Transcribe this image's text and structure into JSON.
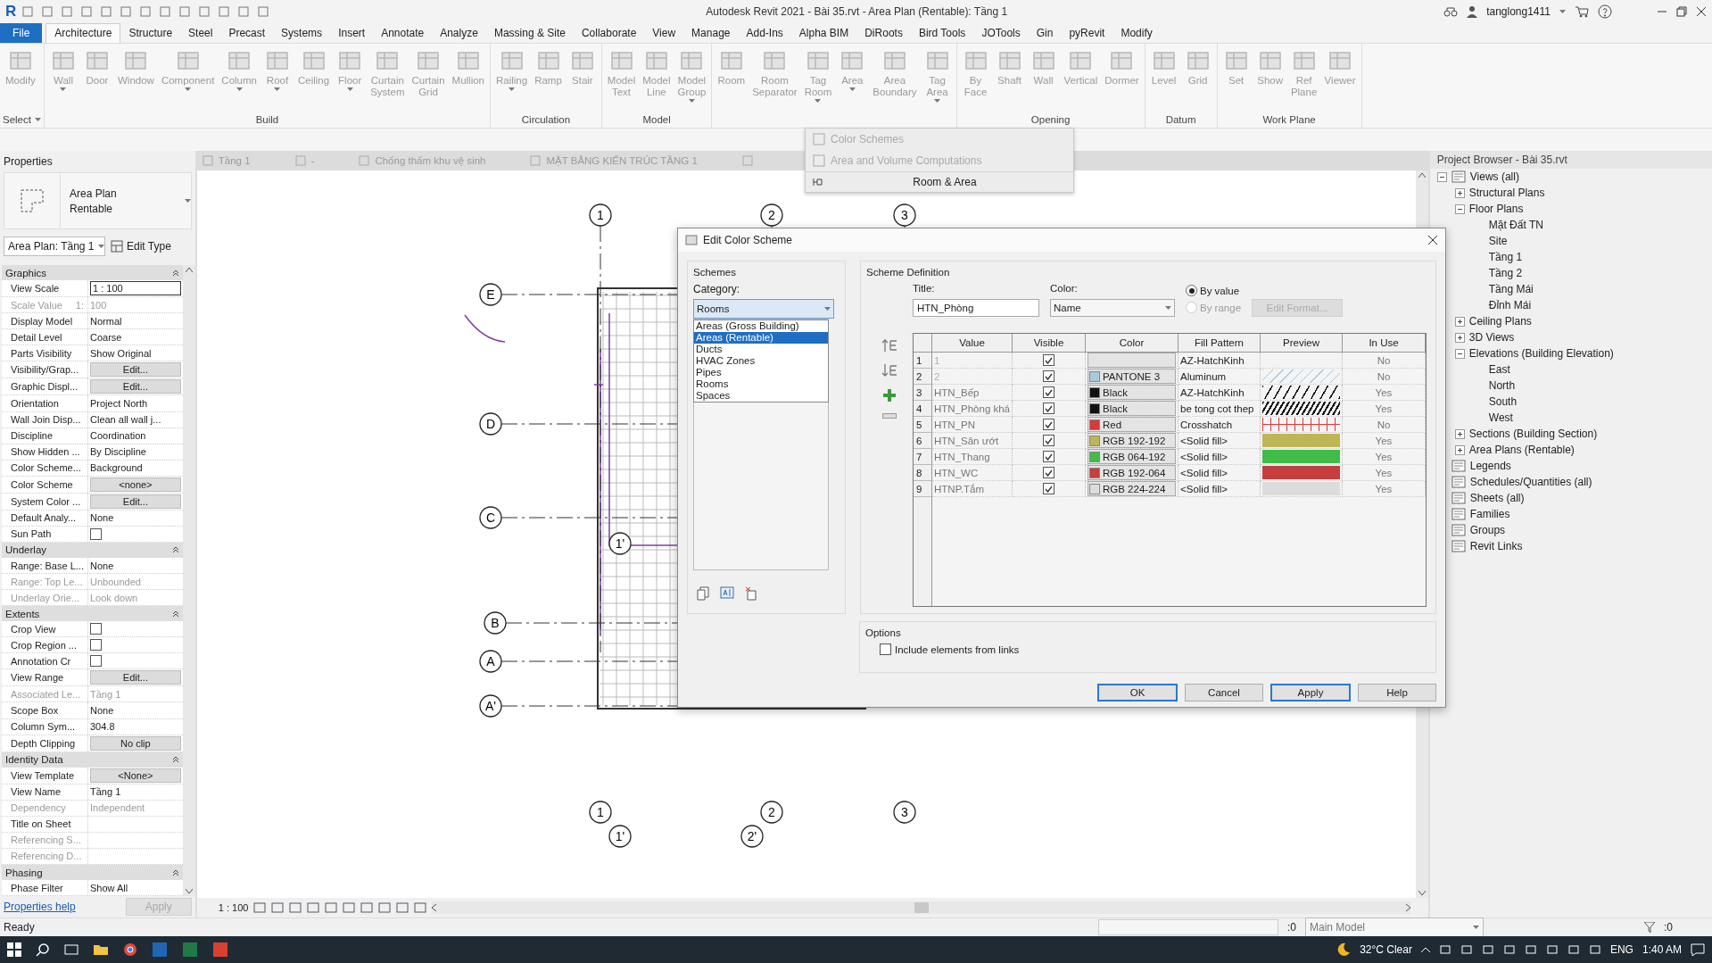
{
  "window": {
    "logo": "R",
    "title": "Autodesk Revit 2021 - Bài 35.rvt - Area Plan (Rentable): Tầng 1",
    "user": "tanglong1411"
  },
  "ribbon_tabs": [
    {
      "label": "File",
      "kind": "file",
      "selected": false
    },
    {
      "label": "Architecture",
      "kind": "tab",
      "selected": true
    },
    {
      "label": "Structure",
      "kind": "tab",
      "selected": false
    },
    {
      "label": "Steel",
      "kind": "tab",
      "selected": false
    },
    {
      "label": "Precast",
      "kind": "tab",
      "selected": false
    },
    {
      "label": "Systems",
      "kind": "tab",
      "selected": false
    },
    {
      "label": "Insert",
      "kind": "tab",
      "selected": false
    },
    {
      "label": "Annotate",
      "kind": "tab",
      "selected": false
    },
    {
      "label": "Analyze",
      "kind": "tab",
      "selected": false
    },
    {
      "label": "Massing & Site",
      "kind": "tab",
      "selected": false
    },
    {
      "label": "Collaborate",
      "kind": "tab",
      "selected": false
    },
    {
      "label": "View",
      "kind": "tab",
      "selected": false
    },
    {
      "label": "Manage",
      "kind": "tab",
      "selected": false
    },
    {
      "label": "Add-Ins",
      "kind": "tab",
      "selected": false
    },
    {
      "label": "Alpha BIM",
      "kind": "tab",
      "selected": false
    },
    {
      "label": "DiRoots",
      "kind": "tab",
      "selected": false
    },
    {
      "label": "Bird Tools",
      "kind": "tab",
      "selected": false
    },
    {
      "label": "JOTools",
      "kind": "tab",
      "selected": false
    },
    {
      "label": "Gin",
      "kind": "tab",
      "selected": false
    },
    {
      "label": "pyRevit",
      "kind": "tab",
      "selected": false
    },
    {
      "label": "Modify",
      "kind": "tab",
      "selected": false
    }
  ],
  "ribbon_panels": [
    {
      "label": "Select",
      "dropdown": true,
      "buttons": [
        {
          "label": "Modify",
          "dropdown": false
        }
      ]
    },
    {
      "label": "Build",
      "dropdown": false,
      "buttons": [
        {
          "label": "Wall",
          "dropdown": true
        },
        {
          "label": "Door",
          "dropdown": false
        },
        {
          "label": "Window",
          "dropdown": false
        },
        {
          "label": "Component",
          "dropdown": true
        },
        {
          "label": "Column",
          "dropdown": true
        },
        {
          "label": "Roof",
          "dropdown": true
        },
        {
          "label": "Ceiling",
          "dropdown": false
        },
        {
          "label": "Floor",
          "dropdown": true
        },
        {
          "label": "Curtain System",
          "dropdown": false
        },
        {
          "label": "Curtain Grid",
          "dropdown": false
        },
        {
          "label": "Mullion",
          "dropdown": false
        }
      ]
    },
    {
      "label": "Circulation",
      "dropdown": false,
      "buttons": [
        {
          "label": "Railing",
          "dropdown": true
        },
        {
          "label": "Ramp",
          "dropdown": false
        },
        {
          "label": "Stair",
          "dropdown": false
        }
      ]
    },
    {
      "label": "Model",
      "dropdown": false,
      "buttons": [
        {
          "label": "Model Text",
          "dropdown": false
        },
        {
          "label": "Model Line",
          "dropdown": false
        },
        {
          "label": "Model Group",
          "dropdown": true
        }
      ]
    },
    {
      "dropdown": false,
      "buttons": [
        {
          "label": "Room",
          "dropdown": false
        },
        {
          "label": "Room Separator",
          "dropdown": false
        },
        {
          "label": "Tag Room",
          "dropdown": true
        },
        {
          "label": "Area",
          "dropdown": true
        },
        {
          "label": "Area Boundary",
          "dropdown": false
        },
        {
          "label": "Tag Area",
          "dropdown": true
        }
      ]
    },
    {
      "label": "Opening",
      "dropdown": false,
      "buttons": [
        {
          "label": "By Face",
          "dropdown": false
        },
        {
          "label": "Shaft",
          "dropdown": false
        },
        {
          "label": "Wall",
          "dropdown": false
        },
        {
          "label": "Vertical",
          "dropdown": false
        },
        {
          "label": "Dormer",
          "dropdown": false
        }
      ]
    },
    {
      "label": "Datum",
      "dropdown": false,
      "buttons": [
        {
          "label": "Level",
          "dropdown": false
        },
        {
          "label": "Grid",
          "dropdown": false
        }
      ]
    },
    {
      "label": "Work Plane",
      "dropdown": false,
      "buttons": [
        {
          "label": "Set",
          "dropdown": false
        },
        {
          "label": "Show",
          "dropdown": false
        },
        {
          "label": "Ref Plane",
          "dropdown": false
        },
        {
          "label": "Viewer",
          "dropdown": false
        }
      ]
    }
  ],
  "room_area_menu": {
    "items": [
      {
        "label": "Color Schemes",
        "disabled": true
      },
      {
        "label": "Area and Volume Computations",
        "disabled": true
      }
    ],
    "footer": "Room & Area"
  },
  "view_tabs": [
    {
      "label": "Tầng 1"
    },
    {
      "label": "-"
    },
    {
      "label": "Chống thấm khu vệ sinh"
    },
    {
      "label": "MẶT BẰNG KIẾN TRÚC TẦNG 1"
    }
  ],
  "properties": {
    "title": "Properties",
    "type_name": "Area Plan",
    "type_sub": "Rentable",
    "instance": "Area Plan: Tầng 1",
    "edit_type": "Edit Type",
    "sections": [
      {
        "name": "Graphics",
        "rows": [
          {
            "label": "View Scale",
            "value": "1 : 100",
            "kind": "field",
            "disabled": false
          },
          {
            "label": "Scale Value",
            "prefix": "1:",
            "value": "100",
            "kind": "text",
            "disabled": true
          },
          {
            "label": "Display Model",
            "value": "Normal",
            "kind": "text",
            "disabled": false
          },
          {
            "label": "Detail Level",
            "value": "Coarse",
            "kind": "text",
            "disabled": false
          },
          {
            "label": "Parts Visibility",
            "value": "Show Original",
            "kind": "text",
            "disabled": false
          },
          {
            "label": "Visibility/Grap...",
            "value": "Edit...",
            "kind": "button",
            "disabled": false
          },
          {
            "label": "Graphic Displ...",
            "value": "Edit...",
            "kind": "button",
            "disabled": false
          },
          {
            "label": "Orientation",
            "value": "Project North",
            "kind": "text",
            "disabled": false
          },
          {
            "label": "Wall Join Disp...",
            "value": "Clean all wall j...",
            "kind": "text",
            "disabled": false
          },
          {
            "label": "Discipline",
            "value": "Coordination",
            "kind": "text",
            "disabled": false
          },
          {
            "label": "Show Hidden ...",
            "value": "By Discipline",
            "kind": "text",
            "disabled": false
          },
          {
            "label": "Color Scheme...",
            "value": "Background",
            "kind": "text",
            "disabled": false
          },
          {
            "label": "Color Scheme",
            "value": "<none>",
            "kind": "button",
            "disabled": false
          },
          {
            "label": "System Color ...",
            "value": "Edit...",
            "kind": "button",
            "disabled": false
          },
          {
            "label": "Default Analy...",
            "value": "None",
            "kind": "text",
            "disabled": false
          },
          {
            "label": "Sun Path",
            "kind": "checkbox",
            "checked": false,
            "disabled": false
          }
        ]
      },
      {
        "name": "Underlay",
        "rows": [
          {
            "label": "Range: Base L...",
            "value": "None",
            "kind": "text",
            "disabled": false
          },
          {
            "label": "Range: Top Le...",
            "value": "Unbounded",
            "kind": "text",
            "disabled": true
          },
          {
            "label": "Underlay Orie...",
            "value": "Look down",
            "kind": "text",
            "disabled": true
          }
        ]
      },
      {
        "name": "Extents",
        "rows": [
          {
            "label": "Crop View",
            "kind": "checkbox",
            "checked": false,
            "disabled": false
          },
          {
            "label": "Crop Region ...",
            "kind": "checkbox",
            "checked": false,
            "disabled": false
          },
          {
            "label": "Annotation Cr",
            "kind": "checkbox",
            "checked": false,
            "disabled": false
          },
          {
            "label": "View Range",
            "value": "Edit...",
            "kind": "button",
            "disabled": false
          },
          {
            "label": "Associated Le...",
            "value": "Tầng 1",
            "kind": "text",
            "disabled": true
          },
          {
            "label": "Scope Box",
            "value": "None",
            "kind": "text",
            "disabled": false
          },
          {
            "label": "Column Sym...",
            "value": "304.8",
            "kind": "text",
            "disabled": false
          },
          {
            "label": "Depth Clipping",
            "value": "No clip",
            "kind": "button",
            "disabled": false
          }
        ]
      },
      {
        "name": "Identity Data",
        "rows": [
          {
            "label": "View Template",
            "value": "<None>",
            "kind": "button",
            "disabled": false
          },
          {
            "label": "View Name",
            "value": "Tầng 1",
            "kind": "text",
            "disabled": false
          },
          {
            "label": "Dependency",
            "value": "Independent",
            "kind": "text",
            "disabled": true
          },
          {
            "label": "Title on Sheet",
            "kind": "text",
            "disabled": false
          },
          {
            "label": "Referencing S...",
            "kind": "text",
            "disabled": true
          },
          {
            "label": "Referencing D...",
            "kind": "text",
            "disabled": true
          }
        ]
      },
      {
        "name": "Phasing",
        "rows": [
          {
            "label": "Phase Filter",
            "value": "Show All",
            "kind": "text",
            "disabled": false
          }
        ]
      }
    ],
    "help": "Properties help",
    "apply": "Apply"
  },
  "grid_bubbles": [
    "1",
    "2",
    "3",
    "E",
    "D",
    "C",
    "B",
    "A",
    "A'",
    "1'",
    "1",
    "2",
    "3",
    "1'",
    "2'"
  ],
  "view_bar": {
    "scale": "1 : 100"
  },
  "dialog": {
    "title": "Edit Color Scheme",
    "schemes": {
      "label": "Schemes",
      "category_label": "Category:",
      "category": "Rooms",
      "options": [
        {
          "label": "Areas (Gross Building)",
          "selected": false
        },
        {
          "label": "Areas (Rentable)",
          "selected": true
        },
        {
          "label": "Ducts",
          "selected": false
        },
        {
          "label": "HVAC Zones",
          "selected": false
        },
        {
          "label": "Pipes",
          "selected": false
        },
        {
          "label": "Rooms",
          "selected": false
        },
        {
          "label": "Spaces",
          "selected": false
        }
      ]
    },
    "definition": {
      "label": "Scheme Definition",
      "title_label": "Title:",
      "title": "HTN_Phòng",
      "color_label": "Color:",
      "color_by": "Name",
      "radios": [
        {
          "label": "By value",
          "selected": true,
          "disabled": false
        },
        {
          "label": "By range",
          "selected": false,
          "disabled": true
        }
      ],
      "edit_format": {
        "label": "Edit Format...",
        "disabled": true
      },
      "columns": [
        "Value",
        "Visible",
        "Color",
        "Fill Pattern",
        "Preview",
        "In Use"
      ],
      "rows": [
        {
          "num": "1",
          "value": "1",
          "value_disabled": true,
          "visible": true,
          "fill": "AZ-HatchKinh",
          "kind": "none",
          "in_use": "No"
        },
        {
          "num": "2",
          "value": "2",
          "value_disabled": true,
          "visible": true,
          "color": "#a9c9dd",
          "color_label": "PANTONE 3",
          "fill": "Aluminum",
          "kind": "diagonal",
          "in_use": "No"
        },
        {
          "num": "3",
          "value": "HTN_Bếp",
          "value_disabled": false,
          "visible": true,
          "color": "#111111",
          "color_label": "Black",
          "fill": "AZ-HatchKinh",
          "kind": "hatch",
          "in_use": "Yes"
        },
        {
          "num": "4",
          "value": "HTN_Phòng khá",
          "value_disabled": false,
          "visible": true,
          "color": "#111111",
          "color_label": "Black",
          "fill": "be tong cot thep",
          "kind": "dense",
          "in_use": "Yes"
        },
        {
          "num": "5",
          "value": "HTN_PN",
          "value_disabled": false,
          "visible": true,
          "color": "#d63a3a",
          "color_label": "Red",
          "fill": "Crosshatch",
          "kind": "crosshatch",
          "in_use": "No"
        },
        {
          "num": "6",
          "value": "HTN_Sân ướt",
          "value_disabled": false,
          "visible": true,
          "color": "#bdb654",
          "color_label": "RGB 192-192",
          "fill": "<Solid fill>",
          "kind": "solid",
          "in_use": "Yes"
        },
        {
          "num": "7",
          "value": "HTN_Thang",
          "value_disabled": false,
          "visible": true,
          "color": "#3fbd48",
          "color_label": "RGB 064-192",
          "fill": "<Solid fill>",
          "kind": "solid",
          "in_use": "Yes"
        },
        {
          "num": "8",
          "value": "HTN_WC",
          "value_disabled": false,
          "visible": true,
          "color": "#c53f3f",
          "color_label": "RGB 192-064",
          "fill": "<Solid fill>",
          "kind": "solid",
          "in_use": "Yes"
        },
        {
          "num": "9",
          "value": "HTNP.Tắm",
          "value_disabled": false,
          "visible": true,
          "color": "#dcdcdc",
          "color_label": "RGB 224-224",
          "fill": "<Solid fill>",
          "kind": "solid",
          "in_use": "Yes"
        }
      ]
    },
    "options": {
      "label": "Options",
      "include_links": {
        "label": "Include elements from links",
        "checked": false
      }
    },
    "buttons": [
      {
        "label": "OK",
        "highlighted": true
      },
      {
        "label": "Cancel",
        "highlighted": false
      },
      {
        "label": "Apply",
        "highlighted": true
      },
      {
        "label": "Help",
        "highlighted": false
      }
    ]
  },
  "project_browser": {
    "title": "Project Browser - Bài 35.rvt",
    "tree": [
      {
        "label": "Views (all)",
        "expanded": true,
        "children": [
          {
            "label": "Structural Plans",
            "expanded": false
          },
          {
            "label": "Floor Plans",
            "expanded": true,
            "children": [
              {
                "label": "Mặt Đất TN"
              },
              {
                "label": "Site"
              },
              {
                "label": "Tầng 1"
              },
              {
                "label": "Tầng 2"
              },
              {
                "label": "Tầng Mái"
              },
              {
                "label": "Đỉnh Mái"
              }
            ]
          },
          {
            "label": "Ceiling Plans",
            "expanded": false
          },
          {
            "label": "3D Views",
            "expanded": false
          },
          {
            "label": "Elevations (Building Elevation)",
            "expanded": true,
            "children": [
              {
                "label": "East"
              },
              {
                "label": "North"
              },
              {
                "label": "South"
              },
              {
                "label": "West"
              }
            ]
          },
          {
            "label": "Sections (Building Section)",
            "expanded": false
          },
          {
            "label": "Area Plans (Rentable)",
            "expanded": false
          }
        ]
      },
      {
        "label": "Legends"
      },
      {
        "label": "Schedules/Quantities (all)"
      },
      {
        "label": "Sheets (all)"
      },
      {
        "label": "Families"
      },
      {
        "label": "Groups"
      },
      {
        "label": "Revit Links"
      }
    ]
  },
  "status_bar": {
    "text": "Ready",
    "worksets_count": ":0",
    "model": "Main Model",
    "filter_count": ":0"
  },
  "taskbar": {
    "weather": "32°C Clear",
    "language": "ENG",
    "time": "1:40 AM"
  }
}
